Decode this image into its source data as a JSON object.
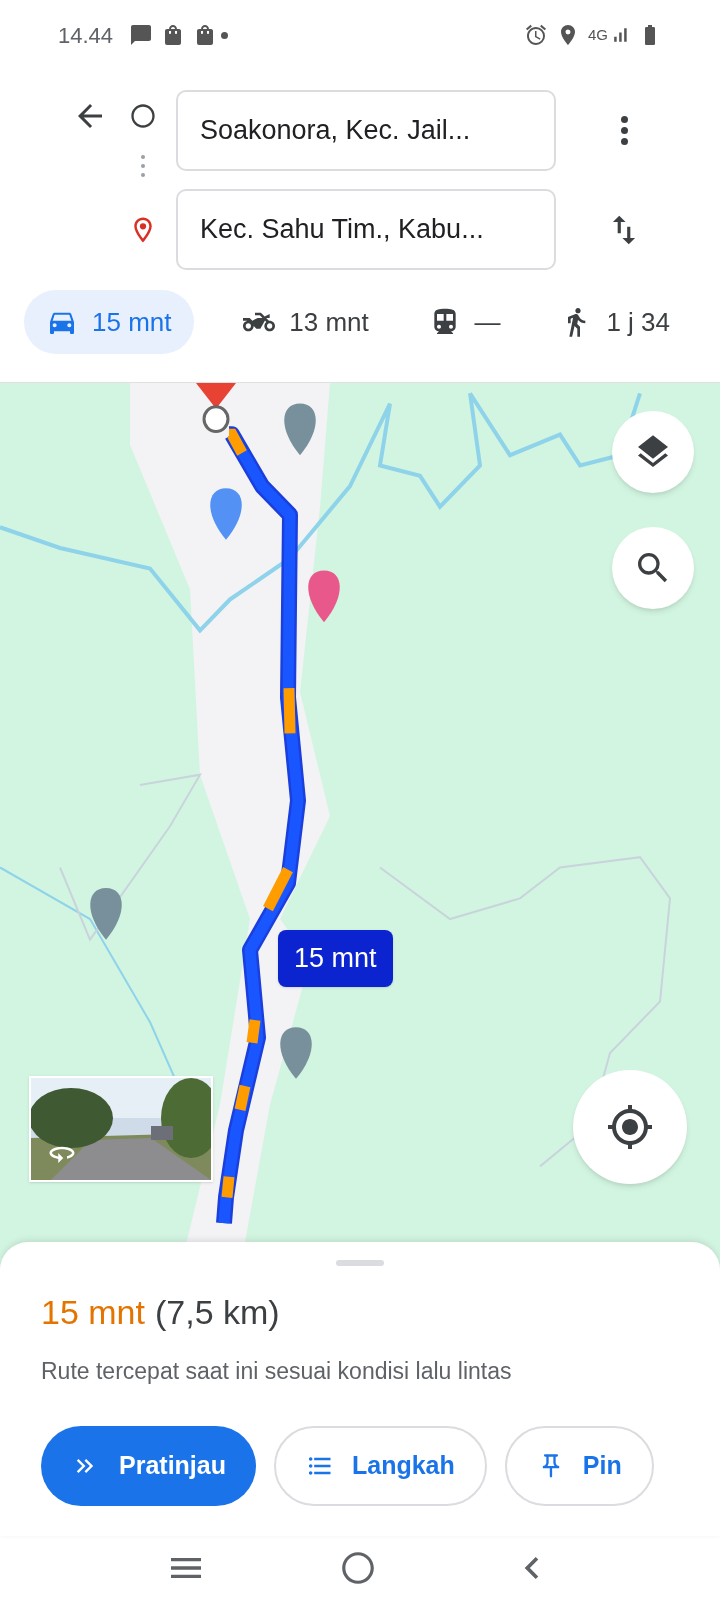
{
  "status_bar": {
    "time": "14.44",
    "network": "4G"
  },
  "directions": {
    "origin": "Soakonora, Kec. Jail...",
    "destination": "Kec. Sahu Tim., Kabu..."
  },
  "modes": [
    {
      "kind": "car",
      "label": "15 mnt",
      "selected": true
    },
    {
      "kind": "motorcycle",
      "label": "13 mnt",
      "selected": false
    },
    {
      "kind": "transit",
      "label": "—",
      "selected": false
    },
    {
      "kind": "walk",
      "label": "1 j 34",
      "selected": false
    }
  ],
  "map": {
    "route_label": "15 mnt"
  },
  "summary": {
    "duration": "15 mnt",
    "distance": "(7,5 km)",
    "description": "Rute tercepat saat ini sesuai kondisi lalu lintas"
  },
  "actions": [
    {
      "kind": "preview",
      "label": "Pratinjau",
      "primary": true
    },
    {
      "kind": "steps",
      "label": "Langkah",
      "primary": false
    },
    {
      "kind": "pin",
      "label": "Pin",
      "primary": false
    }
  ]
}
